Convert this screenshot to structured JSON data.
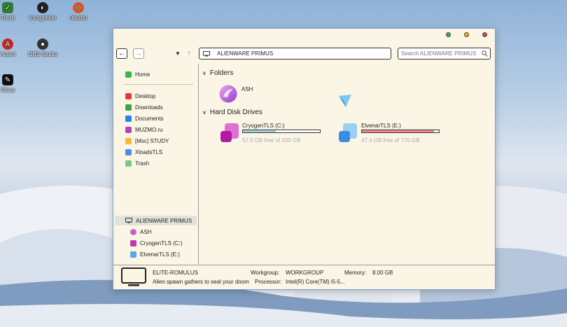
{
  "desktop": {
    "icons": [
      {
        "label": "Trash",
        "icon": "trash-icon"
      },
      {
        "label": "Incognition",
        "icon": "incognito-icon"
      },
      {
        "label": "ubuntu",
        "icon": "ubuntu-icon"
      },
      {
        "label": "Actool",
        "icon": "actool-icon"
      },
      {
        "label": "OBS Studio",
        "icon": "obs-icon"
      },
      {
        "label": "Glass",
        "icon": "glass-icon"
      }
    ]
  },
  "window": {
    "controls": {
      "minimize_color": "#3bb54a",
      "maximize_color": "#e6b800",
      "close_color": "#e0463b"
    },
    "toolbar": {
      "address": "ALIENWARE PRIMUS",
      "search_placeholder": "Search ALIENWARE PRIMUS"
    },
    "sidebar": {
      "home": "Home",
      "places": [
        "Desktop",
        "Downloads",
        "Documents",
        "MUZMO.ru",
        "[Msc] STUDY",
        "XloadsTLS",
        "Trash"
      ],
      "computer": "ALIENWARE PRIMUS",
      "drives": [
        "ASH",
        "CryogenTLS (C:)",
        "ElvenarTLS (E:)"
      ]
    },
    "main": {
      "folders_header": "Folders",
      "folders": [
        {
          "name": "ASH"
        }
      ],
      "drives_header": "Hard Disk Drives",
      "drives": [
        {
          "name": "CryogenTLS (C:)",
          "free": "57.0 GB free of 100 GB",
          "used_fraction": 0.43,
          "bar_color": "#9fd3dd"
        },
        {
          "name": "ElvenarTLS (E:)",
          "free": "47.4 GB free of 770 GB",
          "used_fraction": 0.94,
          "bar_color": "#f08a8f"
        }
      ]
    },
    "status": {
      "computer_name": "ELITE-ROMULUS",
      "description": "Alien spawn gathers to seal your doom",
      "workgroup_label": "Workgroup:",
      "workgroup": "WORKGROUP",
      "memory_label": "Memory:",
      "memory": "8.00 GB",
      "processor_label": "Processor:",
      "processor": "Intel(R) Core(TM) i5-5..."
    }
  }
}
